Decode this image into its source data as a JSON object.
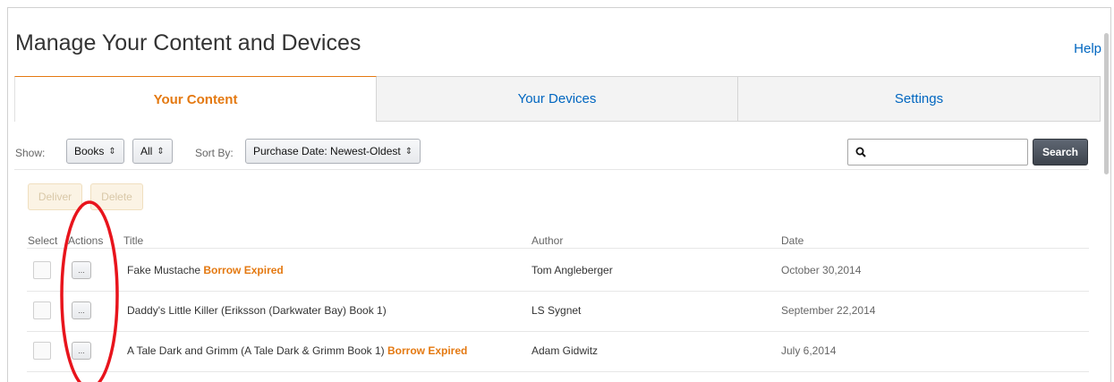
{
  "page": {
    "title": "Manage Your Content and Devices",
    "help_label": "Help"
  },
  "tabs": [
    {
      "label": "Your Content",
      "active": true
    },
    {
      "label": "Your Devices",
      "active": false
    },
    {
      "label": "Settings",
      "active": false
    }
  ],
  "filters": {
    "show_label": "Show:",
    "type_value": "Books",
    "ownership_value": "All",
    "sort_label": "Sort By:",
    "sort_value": "Purchase Date: Newest-Oldest",
    "search_value": "",
    "search_button": "Search"
  },
  "bulk_actions": {
    "deliver_label": "Deliver",
    "delete_label": "Delete"
  },
  "table": {
    "headers": {
      "select": "Select",
      "actions": "Actions",
      "title": "Title",
      "author": "Author",
      "date": "Date"
    },
    "rows": [
      {
        "title": "Fake Mustache",
        "status": "Borrow Expired",
        "author": "Tom Angleberger",
        "date": "October 30,2014",
        "actions_label": "..."
      },
      {
        "title": "Daddy's Little Killer (Eriksson (Darkwater Bay) Book 1)",
        "status": "",
        "author": "LS Sygnet",
        "date": "September 22,2014",
        "actions_label": "..."
      },
      {
        "title": "A Tale Dark and Grimm (A Tale Dark & Grimm Book 1)",
        "status": "Borrow Expired",
        "author": "Adam Gidwitz",
        "date": "July 6,2014",
        "actions_label": "..."
      }
    ]
  },
  "colors": {
    "accent_orange": "#e47911",
    "link_blue": "#0066c0",
    "annotation_red": "#e8141c"
  },
  "icons": {
    "search": "search-icon",
    "select_arrow": "sort-arrows-icon"
  }
}
